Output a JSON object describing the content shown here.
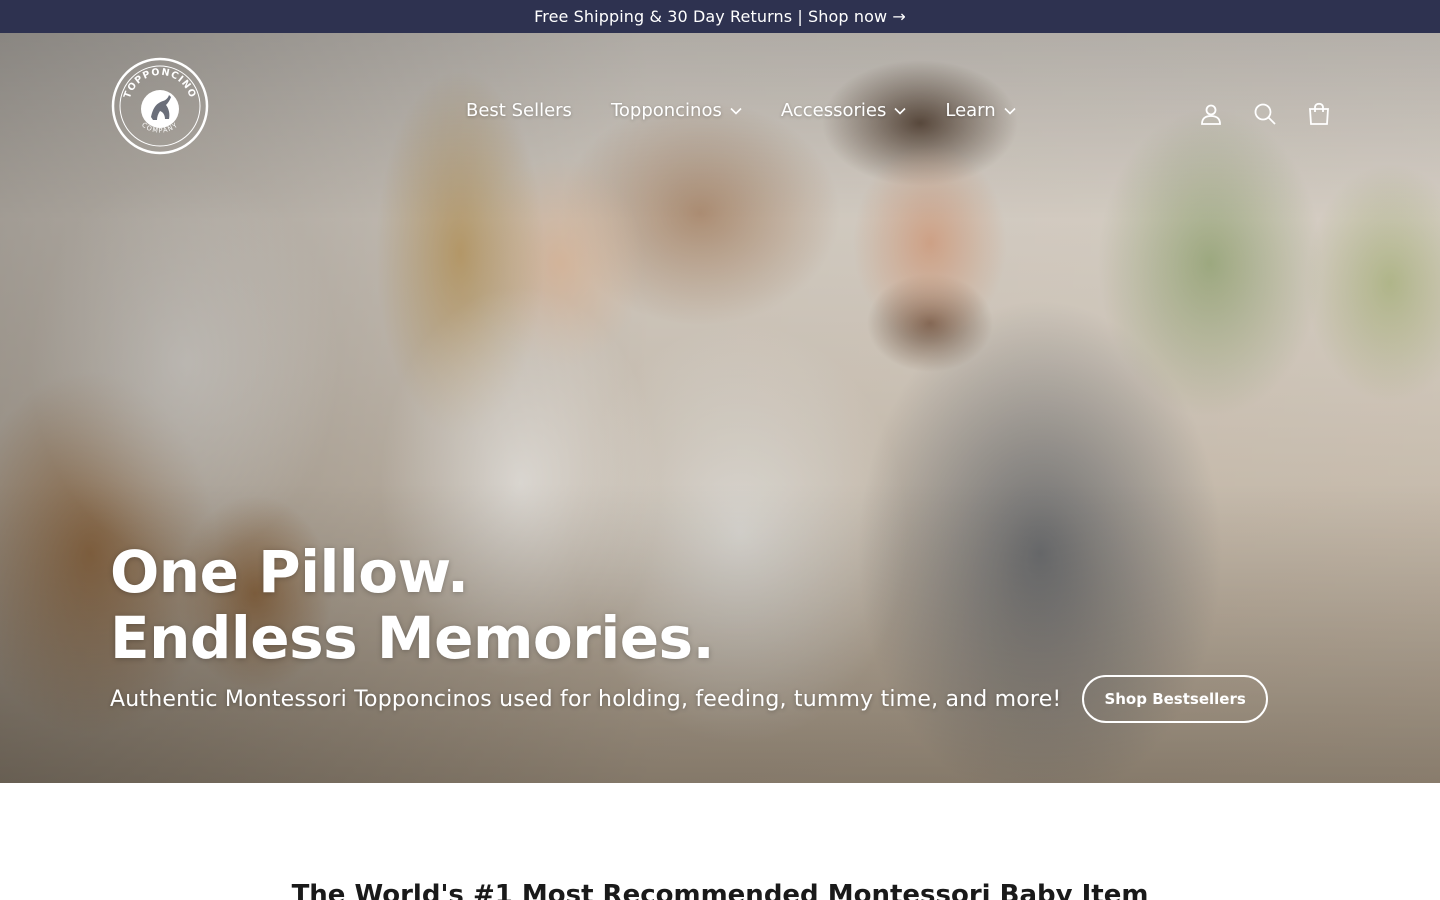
{
  "announcement": {
    "text": "Free Shipping & 30 Day Returns | Shop now →"
  },
  "header": {
    "logo": {
      "top_arc": "TOPPONCINO",
      "bottom_arc": "COMPANY",
      "icon": "kangaroo-map-logo"
    },
    "nav": [
      {
        "label": "Best Sellers",
        "has_dropdown": false
      },
      {
        "label": "Topponcinos",
        "has_dropdown": true
      },
      {
        "label": "Accessories",
        "has_dropdown": true
      },
      {
        "label": "Learn",
        "has_dropdown": true
      }
    ],
    "icons": [
      "user-icon",
      "search-icon",
      "cart-icon"
    ]
  },
  "hero": {
    "title_line1": "One Pillow.",
    "title_line2": "Endless Memories.",
    "subtitle": "Authentic Montessori Topponcinos used for holding, feeding, tummy time, and more!",
    "cta": "Shop Bestsellers",
    "image": "family-holding-newborn-photo"
  },
  "section": {
    "title": "The World's #1 Most Recommended Montessori Baby Item"
  },
  "colors": {
    "announcement_bg": "#2e3250",
    "text_light": "#ffffff",
    "heading_dark": "#1a1a1a"
  }
}
